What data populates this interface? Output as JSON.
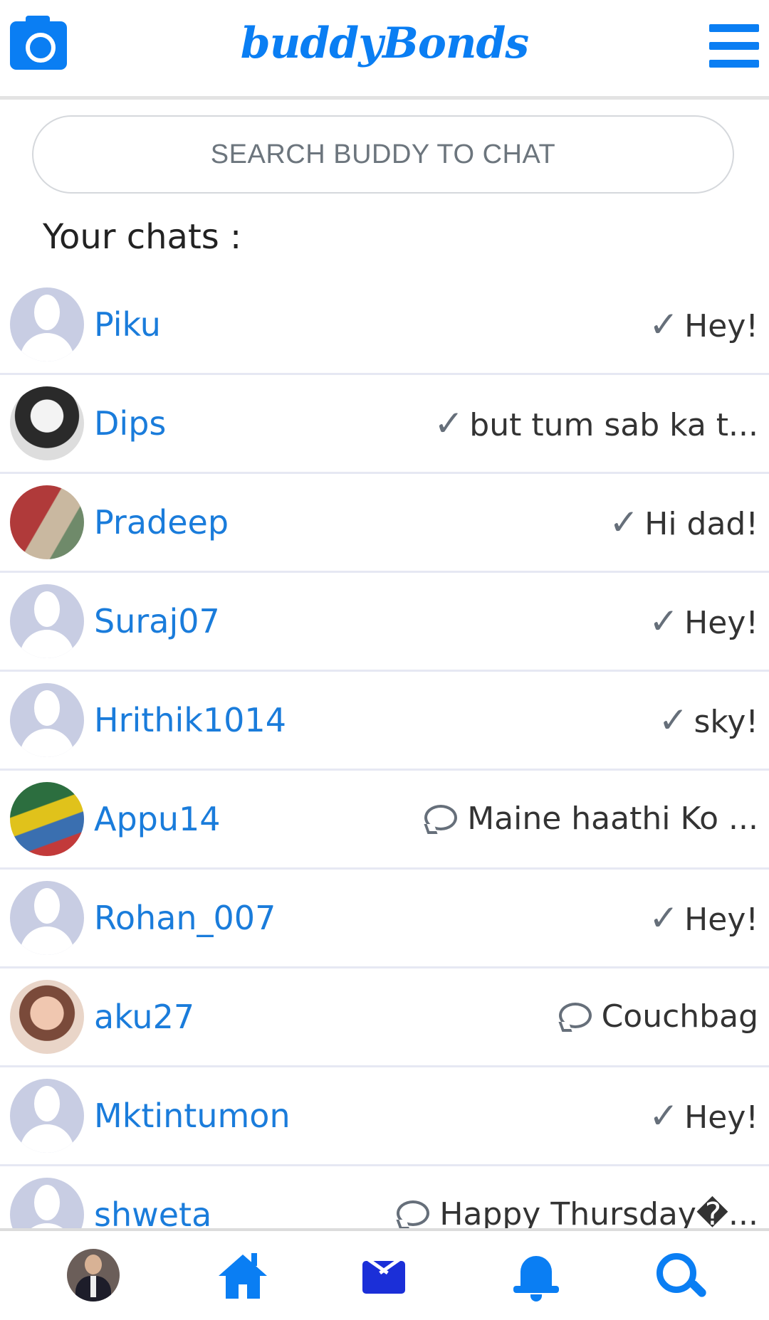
{
  "header": {
    "logo_text": "buddyBonds",
    "camera_icon": "camera-icon",
    "menu_icon": "hamburger-menu-icon"
  },
  "search": {
    "placeholder": "SEARCH BUDDY TO CHAT"
  },
  "section_title": "Your chats :",
  "chats": [
    {
      "name": "Piku",
      "status_icon": "check",
      "last_message": "Hey!",
      "avatar": "default"
    },
    {
      "name": "Dips",
      "status_icon": "check",
      "last_message": "but tum sab ka t...",
      "avatar": "photo"
    },
    {
      "name": "Pradeep",
      "status_icon": "check",
      "last_message": "Hi dad!",
      "avatar": "photo"
    },
    {
      "name": "Suraj07",
      "status_icon": "check",
      "last_message": "Hey!",
      "avatar": "default"
    },
    {
      "name": "Hrithik1014",
      "status_icon": "check",
      "last_message": "sky!",
      "avatar": "default"
    },
    {
      "name": "Appu14",
      "status_icon": "bubble",
      "last_message": "Maine haathi Ko ...",
      "avatar": "photo"
    },
    {
      "name": "Rohan_007",
      "status_icon": "check",
      "last_message": "Hey!",
      "avatar": "default"
    },
    {
      "name": "aku27",
      "status_icon": "bubble",
      "last_message": "Couchbag",
      "avatar": "photo"
    },
    {
      "name": "Mktintumon",
      "status_icon": "check",
      "last_message": "Hey!",
      "avatar": "default"
    },
    {
      "name": "shweta",
      "status_icon": "bubble",
      "last_message": "Happy Thursday�...",
      "avatar": "default"
    }
  ],
  "check_glyph": "✓",
  "bottom_nav": [
    "profile-avatar",
    "home-icon",
    "mail-icon",
    "bell-icon",
    "search-icon"
  ],
  "colors": {
    "accent": "#0a7ef3",
    "name_blue": "#1a7cdb",
    "mail_blue": "#1b2fd8",
    "divider": "#e6e8f3"
  }
}
